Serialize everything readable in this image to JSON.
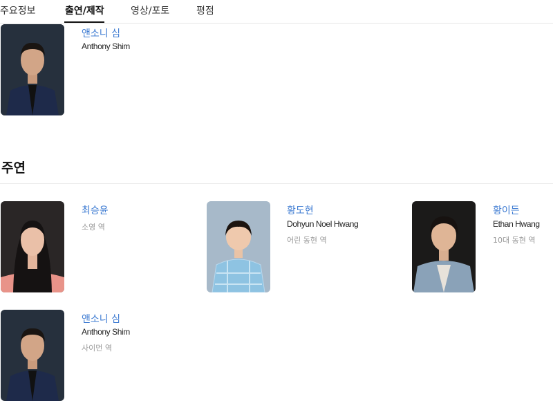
{
  "tabs": [
    {
      "label": "주요정보",
      "active": false
    },
    {
      "label": "출연/제작",
      "active": true
    },
    {
      "label": "영상/포토",
      "active": false
    },
    {
      "label": "평점",
      "active": false
    }
  ],
  "director": {
    "name_ko": "앤소니 심",
    "name_en": "Anthony Shim"
  },
  "lead_section": {
    "title": "주연",
    "cast": [
      {
        "name_ko": "최승윤",
        "name_en": "",
        "role": "소영 역"
      },
      {
        "name_ko": "황도현",
        "name_en": "Dohyun Noel Hwang",
        "role": "어린 동현 역"
      },
      {
        "name_ko": "황이든",
        "name_en": "Ethan Hwang",
        "role": "10대 동현 역"
      },
      {
        "name_ko": "앤소니 심",
        "name_en": "Anthony Shim",
        "role": "사이먼 역"
      }
    ]
  },
  "colors": {
    "link": "#3d7bd2",
    "role_text": "#999999",
    "divider": "#e6e6e6"
  }
}
